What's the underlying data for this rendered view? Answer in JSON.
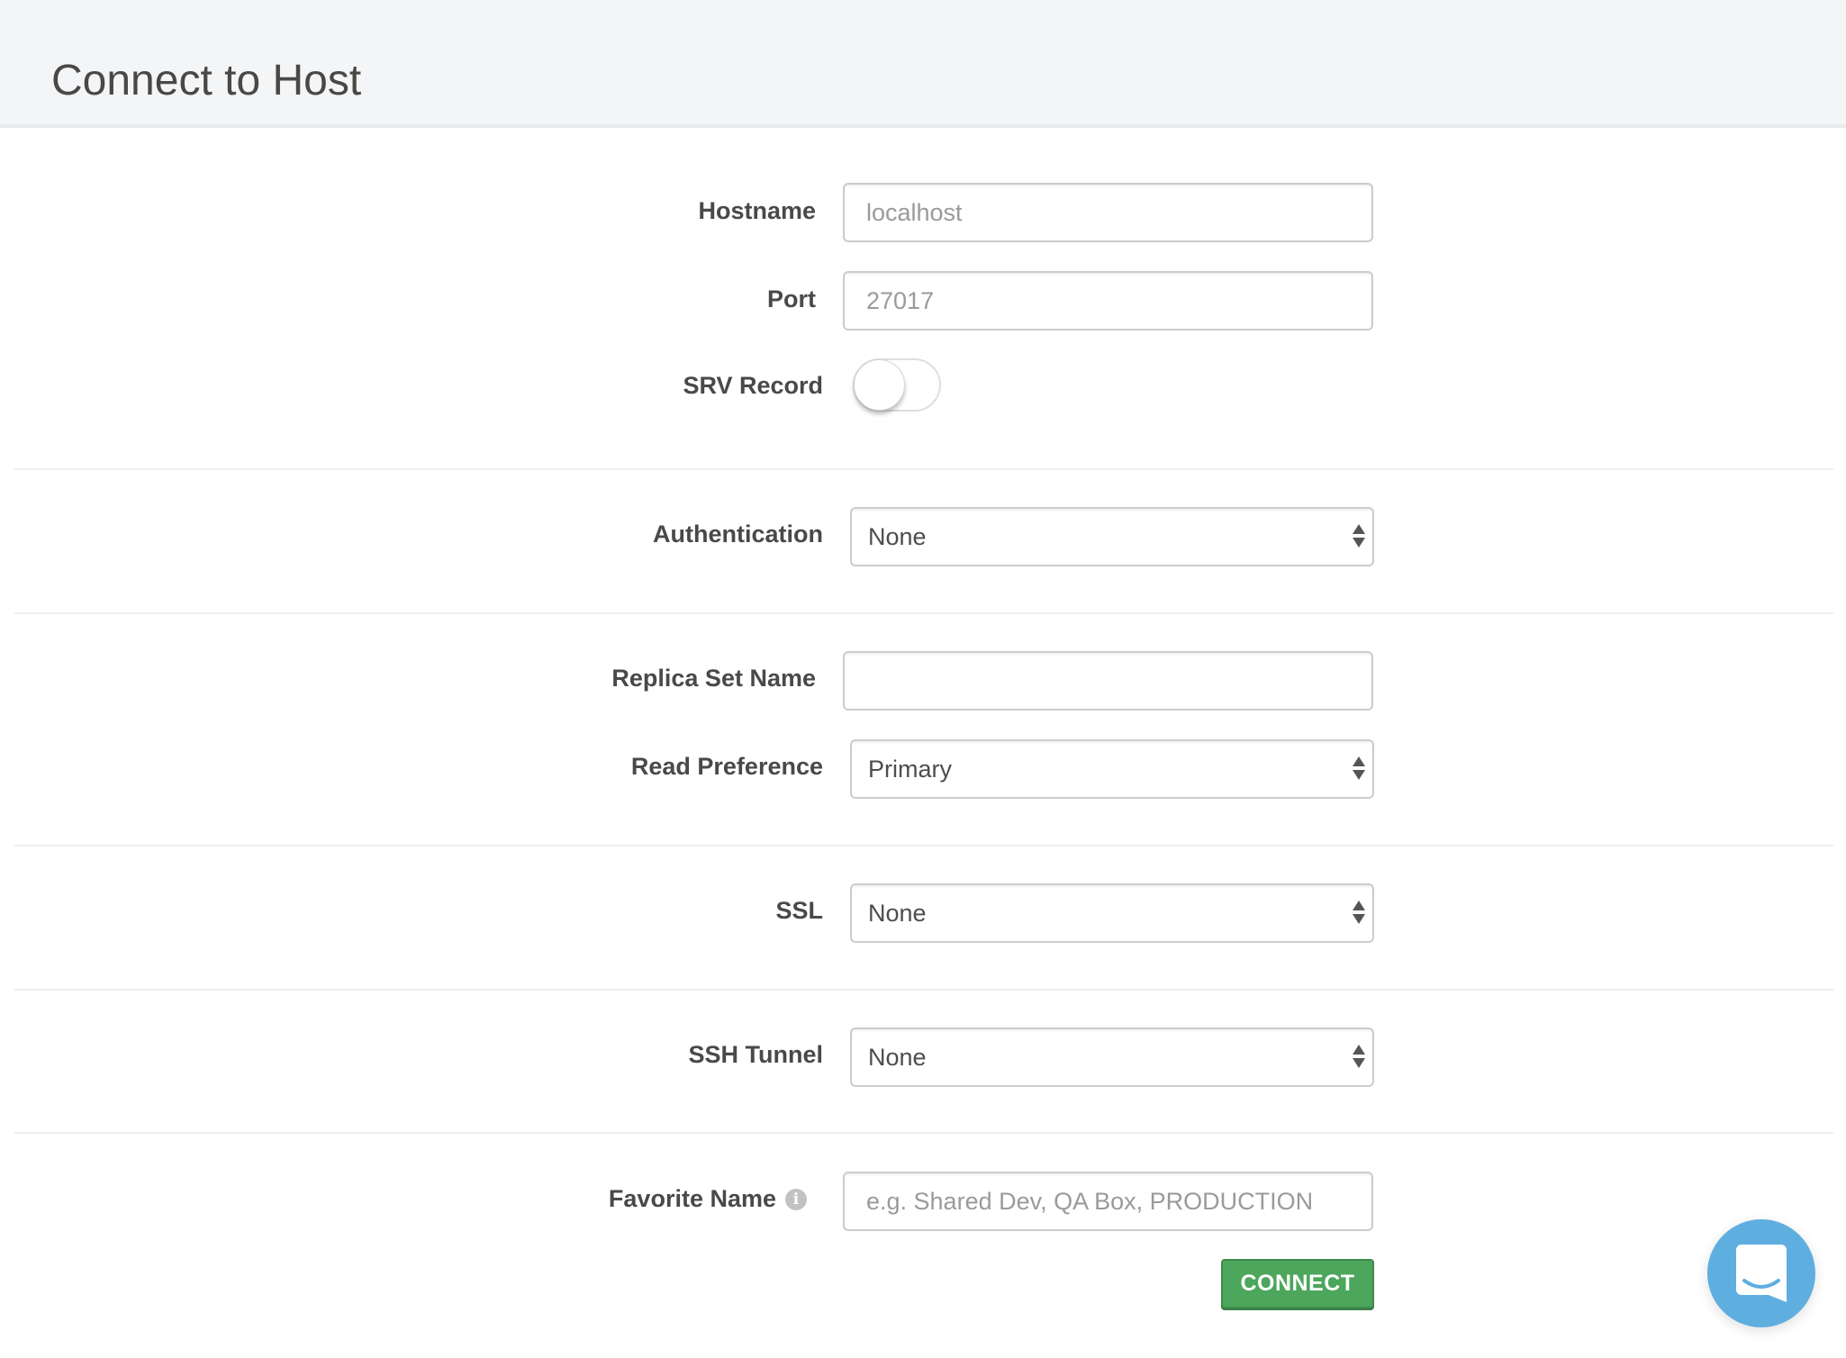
{
  "header": {
    "title": "Connect to Host"
  },
  "form": {
    "hostname": {
      "label": "Hostname",
      "value": "",
      "placeholder": "localhost"
    },
    "port": {
      "label": "Port",
      "value": "",
      "placeholder": "27017"
    },
    "srv_record": {
      "label": "SRV Record",
      "enabled": false
    },
    "authentication": {
      "label": "Authentication",
      "selected": "None"
    },
    "replica_set_name": {
      "label": "Replica Set Name",
      "value": "",
      "placeholder": ""
    },
    "read_preference": {
      "label": "Read Preference",
      "selected": "Primary"
    },
    "ssl": {
      "label": "SSL",
      "selected": "None"
    },
    "ssh_tunnel": {
      "label": "SSH Tunnel",
      "selected": "None"
    },
    "favorite_name": {
      "label": "Favorite Name",
      "value": "",
      "placeholder": "e.g. Shared Dev, QA Box, PRODUCTION",
      "info_icon": "info-icon"
    },
    "connect_label": "CONNECT"
  },
  "chat_widget": {
    "icon": "chat-bubble-icon"
  },
  "colors": {
    "connect_button": "#4ca65c",
    "chat_widget": "#5faee0",
    "header_bg": "#f4f5f7"
  }
}
